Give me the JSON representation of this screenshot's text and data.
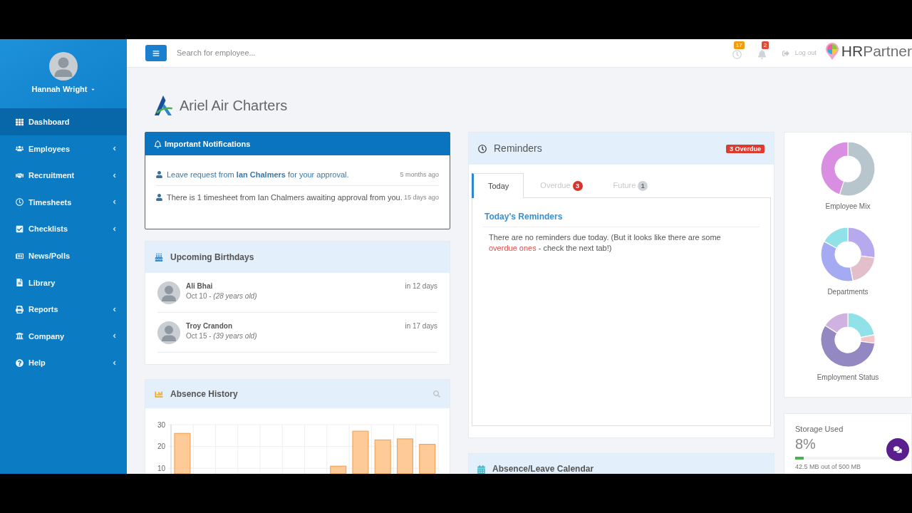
{
  "sidebar": {
    "user_name": "Hannah Wright",
    "items": [
      {
        "label": "Dashboard",
        "selected": true,
        "has_submenu": false
      },
      {
        "label": "Employees",
        "selected": false,
        "has_submenu": true
      },
      {
        "label": "Recruitment",
        "selected": false,
        "has_submenu": true
      },
      {
        "label": "Timesheets",
        "selected": false,
        "has_submenu": true
      },
      {
        "label": "Checklists",
        "selected": false,
        "has_submenu": true
      },
      {
        "label": "News/Polls",
        "selected": false,
        "has_submenu": false
      },
      {
        "label": "Library",
        "selected": false,
        "has_submenu": false
      },
      {
        "label": "Reports",
        "selected": false,
        "has_submenu": true
      },
      {
        "label": "Company",
        "selected": false,
        "has_submenu": true
      },
      {
        "label": "Help",
        "selected": false,
        "has_submenu": true
      }
    ]
  },
  "top_bar": {
    "search": {
      "placeholder": "Search for employee..."
    },
    "alerts": [
      {
        "kind": "clock",
        "count": "17",
        "color": "#f39c12"
      },
      {
        "kind": "bell",
        "count": "2",
        "color": "#dd4b39"
      }
    ],
    "logout": "Log out",
    "brand": "**HR**Partner"
  },
  "company": {
    "name": "Ariel Air Charters"
  },
  "notifications": {
    "title": "Important Notifications",
    "items": [
      {
        "kind": "link",
        "text": "Leave request from **Ian Chalmers** for your approval.",
        "time": "5 months ago"
      },
      {
        "kind": "plain",
        "text": "There is 1 timesheet from Ian Chalmers awaiting approval from you.",
        "time": "15 days ago"
      }
    ]
  },
  "birthdays": {
    "title": "Upcoming Birthdays",
    "items": [
      {
        "name": "Ali Bhai",
        "date": "Oct 10 - *(28 years old)*",
        "due": "in 12 days"
      },
      {
        "name": "Troy Crandon",
        "date": "Oct 15 - *(39 years old)*",
        "due": "in 17 days"
      }
    ]
  },
  "absence_history": {
    "title": "Absence History",
    "chart_data": {
      "type": "bar",
      "values": [
        26,
        null,
        null,
        null,
        null,
        null,
        null,
        11,
        27,
        23,
        23.5,
        21
      ],
      "ylim": [
        7.5,
        30
      ],
      "yticks": [
        10,
        20,
        30
      ]
    }
  },
  "reminders": {
    "title": "Reminders",
    "overdue_badge": "3 Overdue",
    "tabs": [
      {
        "label": "Today",
        "selected": true
      },
      {
        "label": "Overdue",
        "kind": "alert",
        "count": "3",
        "selected": false
      },
      {
        "label": "Future",
        "kind": "info",
        "count": "1",
        "selected": false
      }
    ],
    "panel": {
      "title": "Today's Reminders",
      "message": {
        "before": "There are no reminders due today. (But it looks like there are some",
        "link": "overdue ones",
        "after": "- check the next tab!)"
      }
    }
  },
  "absence_calendar": {
    "title": "Absence/Leave Calendar"
  },
  "charts": [
    {
      "title": "Employee Mix"
    },
    {
      "title": "Departments"
    },
    {
      "title": "Employment Status"
    }
  ],
  "storage": {
    "title": "Storage Used",
    "percent": "8%",
    "level": 0.09,
    "detail": "42.5 MB out of 500 MB"
  }
}
